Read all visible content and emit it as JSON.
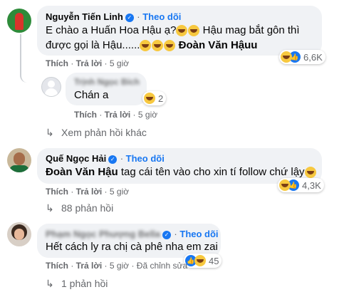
{
  "c1": {
    "name": "Nguyễn Tiến Linh",
    "follow": "Theo dõi",
    "line1": "E chào a Huấn Hoa Hậu ạ?",
    "line1b": "Hậu mag bắt gôn thì",
    "line2": "được gọi là Hậu......",
    "tag": "Đoàn Văn Hậuu",
    "reaction_count": "6,6K"
  },
  "reply1": {
    "name": "Trịnh Ngọc Bích",
    "text": "Chán a",
    "reaction_count": "2",
    "like": "Thích",
    "reply": "Trả lời",
    "time": "5 giờ"
  },
  "more1": "Xem phản hồi khác",
  "c2": {
    "name": "Quế Ngọc Hải",
    "follow": "Theo dõi",
    "tag": "Đoàn Văn Hậu",
    "text": "tag cái tên vào cho xin tí follow chứ lậy",
    "reaction_count": "4,3K",
    "like": "Thích",
    "reply": "Trả lời",
    "time": "5 giờ"
  },
  "more2": "88 phản hồi",
  "c3": {
    "name": "Phạm Ngọc Phượng Bella",
    "follow": "Theo dõi",
    "text": "Hết cách ly ra chị cà phê nha em zai",
    "reaction_count": "45",
    "like": "Thích",
    "reply": "Trả lời",
    "time": "5 giờ",
    "edited": "Đã chỉnh sửa"
  },
  "more3": "1 phản hồi",
  "c1_actions": {
    "like": "Thích",
    "reply": "Trả lời",
    "time": "5 giờ"
  },
  "colors": {
    "link": "#1877f2",
    "bubble": "#f0f2f5",
    "muted": "#65676b"
  }
}
